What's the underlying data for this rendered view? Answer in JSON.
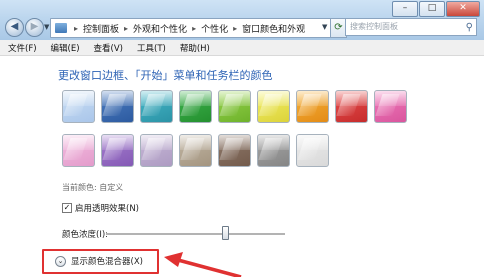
{
  "window": {
    "controls": [
      "–",
      "□",
      "✕"
    ]
  },
  "nav": {
    "back_glyph": "◀",
    "forward_glyph": "▶",
    "dropdown_glyph": "▼"
  },
  "address": {
    "icon": "folder-icon",
    "crumbs": [
      "控制面板",
      "外观和个性化",
      "个性化",
      "窗口颜色和外观"
    ],
    "separator": "▸",
    "dropdown_glyph": "▼",
    "refresh_glyph": "⟳"
  },
  "search": {
    "placeholder": "搜索控制面板",
    "icon_glyph": "⚲"
  },
  "menu": {
    "items": [
      "文件(F)",
      "编辑(E)",
      "查看(V)",
      "工具(T)",
      "帮助(H)"
    ]
  },
  "content": {
    "heading": "更改窗口边框、「开始」菜单和任务栏的颜色",
    "swatch_colors": [
      [
        "#c9def4",
        "#aac6ea"
      ],
      [
        "#4f7fc2",
        "#2c5aa0"
      ],
      [
        "#47b8c9",
        "#2b93a6"
      ],
      [
        "#3fb34e",
        "#24902f"
      ],
      [
        "#96d34c",
        "#6eb22b"
      ],
      [
        "#f3f06a",
        "#dcd33a"
      ],
      [
        "#f6b23b",
        "#e38b16"
      ],
      [
        "#e84f4f",
        "#c62c2c"
      ],
      [
        "#f07cbc",
        "#d9559d"
      ],
      [
        "#f3bde0",
        "#e39bcb"
      ],
      [
        "#a680cf",
        "#8459b5"
      ],
      [
        "#c8b9d8",
        "#ad9bc2"
      ],
      [
        "#c2b7a5",
        "#a49580"
      ],
      [
        "#907a6b",
        "#735b4c"
      ],
      [
        "#a8a8a8",
        "#858585"
      ],
      [
        "#ececec",
        "#d9d9d9"
      ]
    ],
    "current_color": "当前颜色: 自定义",
    "transparency": {
      "checked": true,
      "check_glyph": "✓",
      "label": "启用透明效果(N)"
    },
    "intensity": {
      "label": "颜色浓度(I):",
      "level_fraction": 0.67
    },
    "mixer": {
      "glyph": "⌄",
      "label": "显示颜色混合器(X)"
    },
    "annotation_color": "#e03131"
  }
}
